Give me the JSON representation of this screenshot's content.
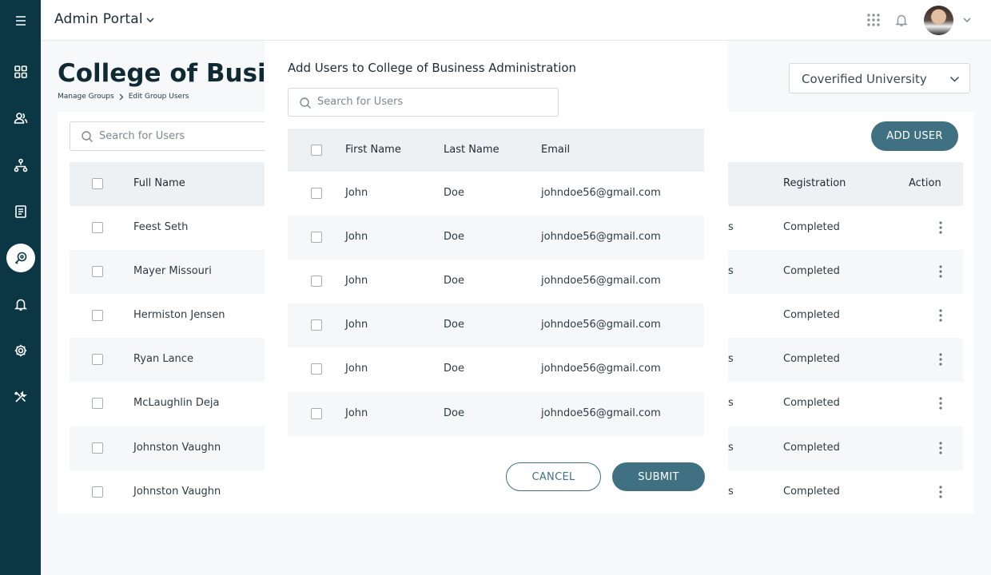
{
  "topbar": {
    "title": "Admin Portal"
  },
  "page": {
    "title": "College of Business Administration",
    "breadcrumb": [
      "Manage Groups",
      "Edit Group Users"
    ],
    "organization": "Coverified University",
    "search_placeholder": "Search for Users",
    "add_user_label": "ADD USER"
  },
  "sidebar": {
    "icons": [
      "menu-icon",
      "dashboard-icon",
      "users-icon",
      "hierarchy-icon",
      "documents-icon",
      "search-key-icon",
      "bell-icon",
      "settings-icon",
      "tools-icon"
    ],
    "active": "search-key-icon"
  },
  "table": {
    "headers": {
      "full_name": "Full Name",
      "registration": "Registration",
      "action": "Action"
    },
    "rows": [
      {
        "name": "Feest Seth",
        "frag": "s",
        "registration": "Completed"
      },
      {
        "name": "Mayer Missouri",
        "frag": "s",
        "registration": "Completed"
      },
      {
        "name": "Hermiston Jensen",
        "frag": "",
        "registration": "Completed"
      },
      {
        "name": "Ryan Lance",
        "frag": "s",
        "registration": "Completed"
      },
      {
        "name": "McLaughlin Deja",
        "frag": "s",
        "registration": "Completed"
      },
      {
        "name": "Johnston Vaughn",
        "frag": "s",
        "registration": "Completed"
      },
      {
        "name": "Johnston Vaughn",
        "frag": "s",
        "registration": "Completed"
      }
    ]
  },
  "modal": {
    "title": "Add Users to College of Business Administration",
    "search_placeholder": "Search for Users",
    "headers": {
      "first": "First Name",
      "last": "Last Name",
      "email": "Email"
    },
    "rows": [
      {
        "first": "John",
        "last": "Doe",
        "email": "johndoe56@gmail.com"
      },
      {
        "first": "John",
        "last": "Doe",
        "email": "johndoe56@gmail.com"
      },
      {
        "first": "John",
        "last": "Doe",
        "email": "johndoe56@gmail.com"
      },
      {
        "first": "John",
        "last": "Doe",
        "email": "johndoe56@gmail.com"
      },
      {
        "first": "John",
        "last": "Doe",
        "email": "johndoe56@gmail.com"
      },
      {
        "first": "John",
        "last": "Doe",
        "email": "johndoe56@gmail.com"
      }
    ],
    "cancel_label": "CANCEL",
    "submit_label": "SUBMIT"
  }
}
